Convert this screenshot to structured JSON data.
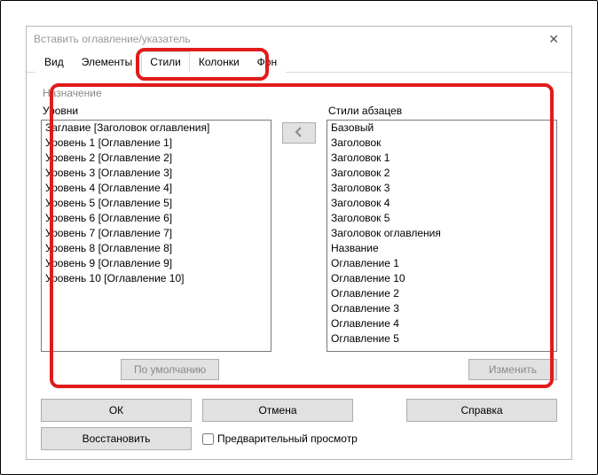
{
  "dialog": {
    "title": "Вставить оглавление/указатель"
  },
  "tabs": {
    "t0": "Вид",
    "t1": "Элементы",
    "t2": "Стили",
    "t3": "Колонки",
    "t4": "Фон"
  },
  "section": {
    "assign_label": "Назначение"
  },
  "left": {
    "header": "Уровни",
    "items": [
      "Заглавие [Заголовок оглавления]",
      "Уровень 1 [Оглавление 1]",
      "Уровень 2 [Оглавление 2]",
      "Уровень 3 [Оглавление 3]",
      "Уровень 4 [Оглавление 4]",
      "Уровень 5 [Оглавление 5]",
      "Уровень 6 [Оглавление 6]",
      "Уровень 7 [Оглавление 7]",
      "Уровень 8 [Оглавление 8]",
      "Уровень 9 [Оглавление 9]",
      "Уровень 10 [Оглавление 10]"
    ]
  },
  "right": {
    "header": "Стили абзацев",
    "items": [
      "Базовый",
      "Заголовок",
      "Заголовок 1",
      "Заголовок 2",
      "Заголовок 3",
      "Заголовок 4",
      "Заголовок 5",
      "Заголовок оглавления",
      "Название",
      "Оглавление 1",
      "Оглавление 10",
      "Оглавление 2",
      "Оглавление 3",
      "Оглавление 4",
      "Оглавление 5"
    ]
  },
  "buttons": {
    "default": "По умолчанию",
    "edit": "Изменить",
    "ok": "ОК",
    "cancel": "Отмена",
    "help": "Справка",
    "restore": "Восстановить",
    "preview": "Предварительный просмотр"
  }
}
